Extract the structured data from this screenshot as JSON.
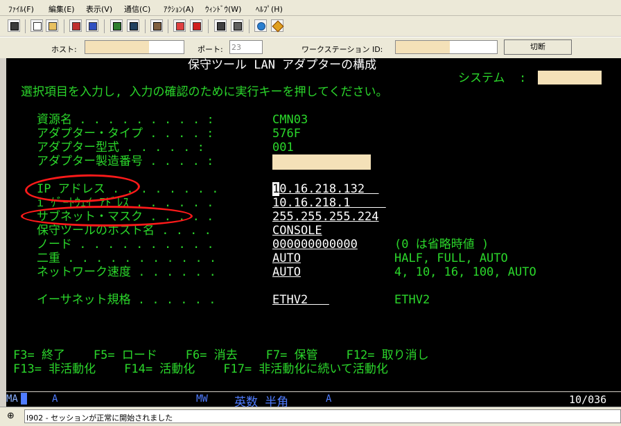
{
  "menu": [
    "ﾌｧｲﾙ(F)",
    "編集(E)",
    "表示(V)",
    "通信(C)",
    "ｱｸｼｮﾝ(A)",
    "ｳｨﾝﾄﾞｳ(W)",
    "ﾍﾙﾌﾟ(H)"
  ],
  "hostbar": {
    "host_label": "ホスト:",
    "port_label": "ポート:",
    "port_value": "23",
    "ws_label": "ワークステーション ID:",
    "disconnect": "切断"
  },
  "screen": {
    "title": "保守ツール LAN アダプターの構成",
    "system_label": "システム  :",
    "instruction": "選択項目を入力し, 入力の確認のために実行キーを押してください。",
    "fields": {
      "resource_label": "資源名 . . . . . . . . . :",
      "resource_value": "CMN03",
      "adapter_type_label": "アダプター・タイプ . . . . :",
      "adapter_type_value": "576F",
      "adapter_model_label": "アダプター型式 . . . . . :",
      "adapter_model_value": "001",
      "serial_label": "アダプター製造番号 . . . . :",
      "ip_label": "IP アドレス . . . . . . . .",
      "ip_cursor": "1",
      "ip_value": "0.16.218.132  ",
      "gateway_label": "i ｹﾞｰﾄｳｪｲ ｱﾄﾞﾚｽ . . . . . .",
      "gateway_value": "10.16.218.1     ",
      "subnet_label": "サブネット・マスク . . . . .",
      "subnet_value": "255.255.255.224",
      "host_name_label": "保守ツールのホスト名 . . . .",
      "host_name_value": "CONSOLE",
      "node_label": "ノード . . . . . . . . . .",
      "node_value": "000000000000",
      "node_hint": "(0 は省略時値 )",
      "duplex_label": "二重 . . . . . . . . . . .",
      "duplex_value": "AUTO",
      "duplex_options": "HALF, FULL, AUTO",
      "speed_label": "ネットワーク速度 . . . . . .",
      "speed_value": "AUTO",
      "speed_options": "4, 10, 16, 100, AUTO",
      "ethernet_label": "イーサネット規格 . . . . . .",
      "ethernet_value": "ETHV2   ",
      "ethernet_options": "ETHV2"
    },
    "fkeys_line1": "F3= 終了    F5= ロード    F6= 消去    F7= 保管    F12= 取り消し",
    "fkeys_line2": "F13= 非活動化    F14= 活動化    F17= 非活動化に続いて活動化"
  },
  "oia": {
    "ma": "MA",
    "a1": "A",
    "mw": "MW",
    "ime": "英数 半角",
    "a2": "A",
    "cursor_pos": "10/036"
  },
  "status_message": "I902 - セッションが正常に開始されました",
  "colors": {
    "screen_bg": "#000000",
    "green": "#2bd72b",
    "white": "#ffffff",
    "mask": "#f4e1b8",
    "annotation": "#ff1a1a"
  }
}
